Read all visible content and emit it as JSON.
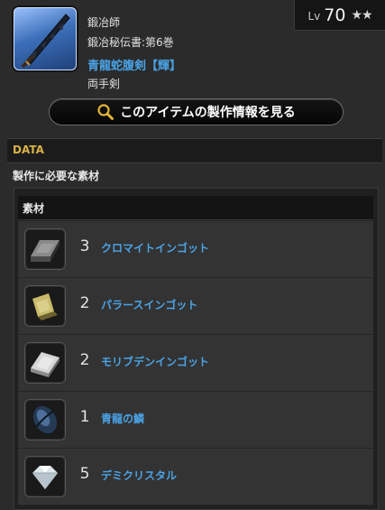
{
  "item": {
    "class_line1": "鍛冶師",
    "class_line2": "鍛冶秘伝書:第6巻",
    "name": "青龍蛇腹剣【輝】",
    "type": "両手剣",
    "icon": "sword-icon"
  },
  "level": {
    "label": "Lv",
    "value": "70",
    "stars": "★★"
  },
  "craft_button": {
    "label": "このアイテムの製作情報を見る",
    "icon": "magnifier-icon"
  },
  "sections": {
    "data_title": "DATA",
    "materials_needed": "製作に必要な素材",
    "materials_header": "素材"
  },
  "materials": [
    {
      "qty": "3",
      "name": "クロマイトインゴット",
      "icon": "chromite-ingot-icon"
    },
    {
      "qty": "2",
      "name": "パラースインゴット",
      "icon": "pallas-ingot-icon"
    },
    {
      "qty": "2",
      "name": "モリブデンインゴット",
      "icon": "molybdenum-ingot-icon"
    },
    {
      "qty": "1",
      "name": "青龍の鱗",
      "icon": "dragon-scale-icon"
    },
    {
      "qty": "5",
      "name": "デミクリスタル",
      "icon": "crystal-icon"
    }
  ],
  "colors": {
    "link_blue": "#4aa3e6",
    "section_gold": "#d9b24a",
    "background": "#2b2b2b"
  }
}
